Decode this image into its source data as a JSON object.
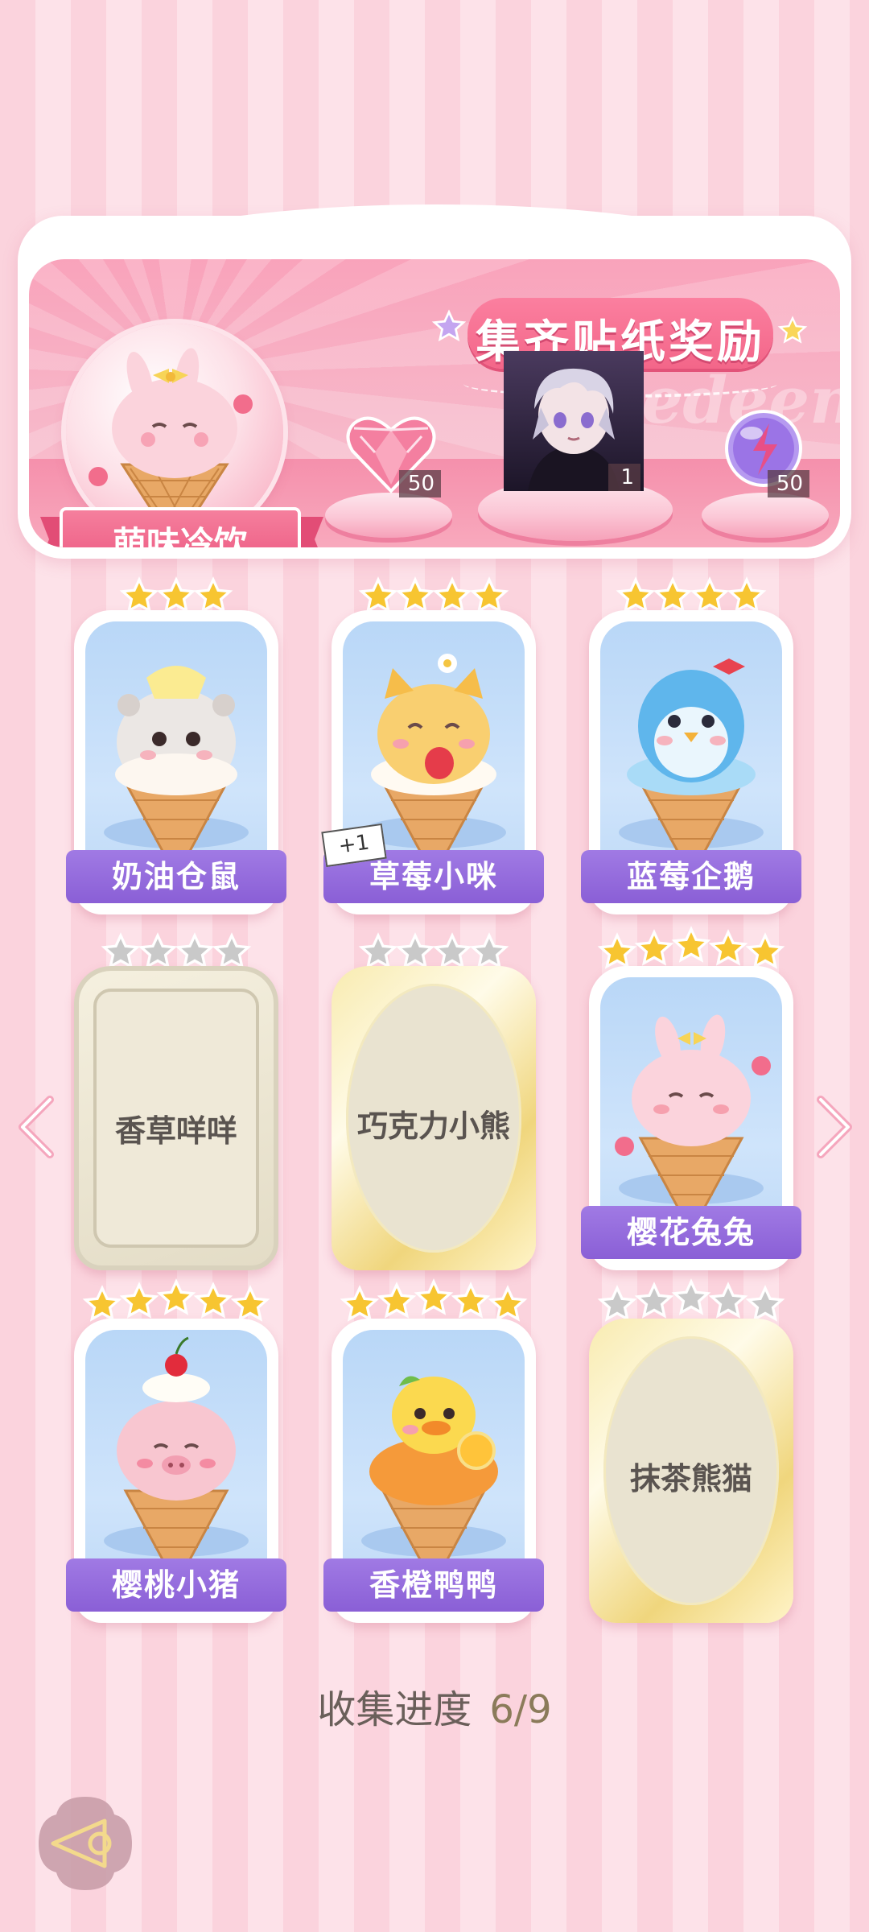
{
  "banner": {
    "title": "集齐贴纸奖励",
    "watermark": "Redeem",
    "album_name": "萌味冷饮",
    "rewards": [
      {
        "icon": "pink-heart-gem-icon",
        "count": "50"
      },
      {
        "icon": "character-portrait",
        "count": "1"
      },
      {
        "icon": "purple-energy-orb-icon",
        "count": "50"
      }
    ]
  },
  "cards": [
    {
      "name": "奶油仓鼠",
      "stars": 3,
      "max_stars": 3,
      "collected": true,
      "art": "hamster-icecream"
    },
    {
      "name": "草莓小咪",
      "stars": 4,
      "max_stars": 4,
      "collected": true,
      "art": "cat-icecream",
      "tag": "+1"
    },
    {
      "name": "蓝莓企鹅",
      "stars": 4,
      "max_stars": 4,
      "collected": true,
      "art": "penguin-icecream"
    },
    {
      "name": "香草咩咩",
      "stars": 0,
      "max_stars": 4,
      "collected": false,
      "art": "locked-silver"
    },
    {
      "name": "巧克力小熊",
      "stars": 0,
      "max_stars": 4,
      "collected": false,
      "art": "locked-gold"
    },
    {
      "name": "樱花兔兔",
      "stars": 5,
      "max_stars": 5,
      "collected": true,
      "art": "bunny-icecream"
    },
    {
      "name": "樱桃小猪",
      "stars": 5,
      "max_stars": 5,
      "collected": true,
      "art": "pig-icecream"
    },
    {
      "name": "香橙鸭鸭",
      "stars": 5,
      "max_stars": 5,
      "collected": true,
      "art": "duck-icecream"
    },
    {
      "name": "抹茶熊猫",
      "stars": 0,
      "max_stars": 5,
      "collected": false,
      "art": "locked-gold"
    }
  ],
  "progress": {
    "label": "收集进度",
    "value": "6/9"
  },
  "colors": {
    "accent_pink": "#f36689",
    "label_purple": "#8a5fd6",
    "star_gold": "#f7c531",
    "star_silver": "#c9c9c9"
  }
}
